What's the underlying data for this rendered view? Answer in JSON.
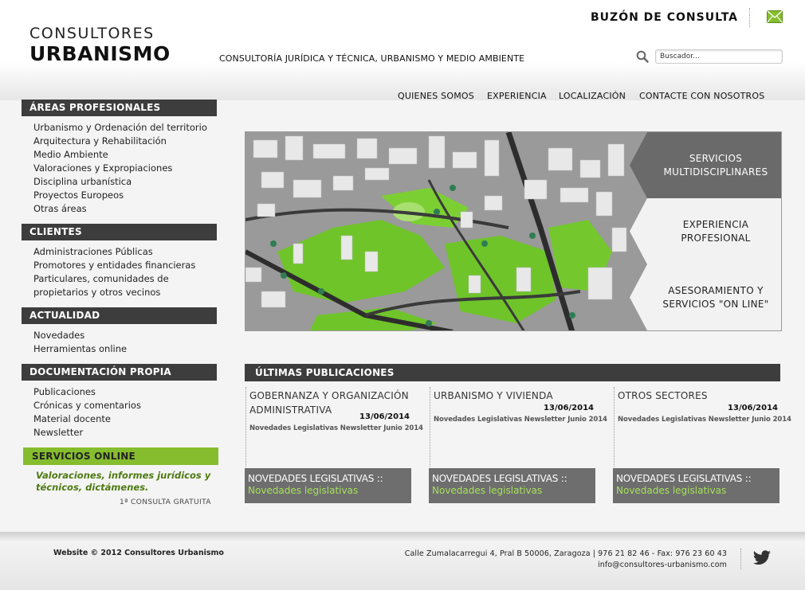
{
  "header": {
    "logo_line1": "CONSULTORES",
    "logo_line2": "URBANISMO",
    "tagline": "CONSULTORÍA JURÍDICA Y TÉCNICA, URBANISMO Y MEDIO AMBIENTE",
    "buzon_label": "BUZÓN DE CONSULTA",
    "mail_icon": "envelope-icon",
    "search_icon": "magnifier-icon",
    "search_placeholder": "Buscador...",
    "nav": [
      "QUIENES SOMOS",
      "EXPERIENCIA",
      "LOCALIZACIÓN",
      "CONTACTE CON NOSOTROS"
    ]
  },
  "sidebar": {
    "areas": {
      "title": "ÁREAS PROFESIONALES",
      "items": [
        "Urbanismo y Ordenación del territorio",
        "Arquitectura y Rehabilitación",
        "Medio Ambiente",
        "Valoraciones y Expropiaciones",
        "Disciplina urbanística",
        "Proyectos Europeos",
        "Otras áreas"
      ]
    },
    "clientes": {
      "title": "CLIENTES",
      "items": [
        "Administraciones Públicas",
        "Promotores y entidades financieras",
        "Particulares, comunidades de",
        "propietarios y otros vecinos"
      ]
    },
    "actualidad": {
      "title": "ACTUALIDAD",
      "items": [
        "Novedades",
        "Herramientas online"
      ]
    },
    "documentacion": {
      "title": "DOCUMENTACIÓN PROPIA",
      "items": [
        "Publicaciones",
        "Crónicas y comentarios",
        "Material docente",
        "Newsletter"
      ]
    },
    "online": {
      "title": "SERVICIOS ONLINE",
      "text_line1": "Valoraciones, informes jurídicos y",
      "text_line2": "técnicos, dictámenes.",
      "free": "1ª CONSULTA GRATUITA"
    }
  },
  "hero": {
    "panels": [
      {
        "line1": "SERVICIOS",
        "line2": "MULTIDISCIPLINARES"
      },
      {
        "line1": "EXPERIENCIA",
        "line2": "PROFESIONAL"
      },
      {
        "line1": "ASESORAMIENTO Y",
        "line2": "SERVICIOS \"ON LINE\""
      }
    ],
    "colors": {
      "active_panel": "#6a6a6a",
      "inactive_panel": "#f2f2f2",
      "green_area": "#6fc42a"
    }
  },
  "publications": {
    "title": "ÚLTIMAS PUBLICACIONES",
    "columns": [
      {
        "title_line1": "GOBERNANZA Y ORGANIZACIÓN",
        "title_line2": "ADMINISTRATIVA",
        "date": "13/06/2014",
        "desc": "Novedades Legislativas Newsletter Junio 2014",
        "box_title": "NOVEDADES LEGISLATIVAS ::",
        "box_link": "Novedades legislativas"
      },
      {
        "title_line1": "URBANISMO Y VIVIENDA",
        "title_line2": "",
        "date": "13/06/2014",
        "desc": "Novedades Legislativas Newsletter Junio 2014",
        "box_title": "NOVEDADES LEGISLATIVAS ::",
        "box_link": "Novedades legislativas"
      },
      {
        "title_line1": "OTROS SECTORES",
        "title_line2": "",
        "date": "13/06/2014",
        "desc": "Novedades Legislativas Newsletter Junio 2014",
        "box_title": "NOVEDADES LEGISLATIVAS ::",
        "box_link": "Novedades legislativas"
      }
    ]
  },
  "footer": {
    "copyright": "Website © 2012 Consultores Urbanismo",
    "address": "Calle Zumalacarregui 4, Pral B 50006, Zaragoza | 976 21 82 46 - Fax: 976 23 60 43",
    "email": "info@consultores-urbanismo.com",
    "social_icon": "twitter-bird-icon"
  }
}
